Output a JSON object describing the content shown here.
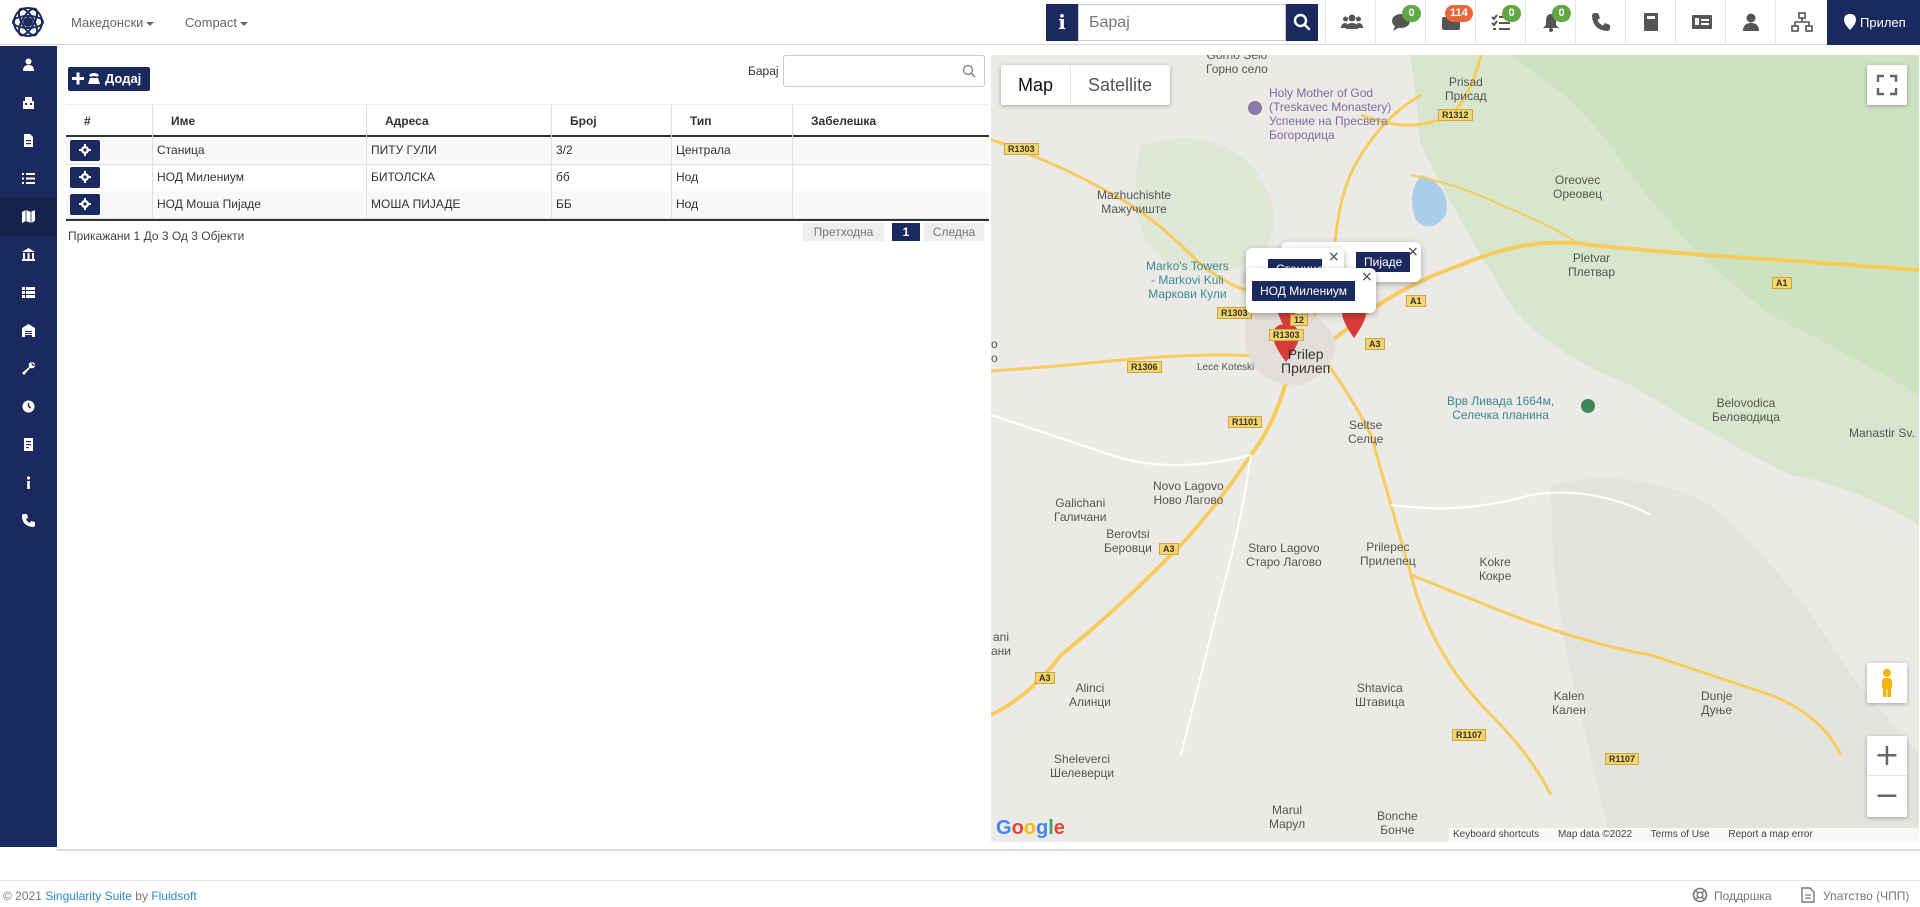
{
  "topbar": {
    "language": "Македонски",
    "view_mode": "Compact",
    "search_placeholder": "Барај",
    "badges": {
      "messages": "0",
      "inbox": "114",
      "tasks": "0",
      "notifications": "0"
    },
    "branch": "Прилеп"
  },
  "toolbar": {
    "add_label": "Додај",
    "filter_label": "Барај"
  },
  "table": {
    "columns": [
      "#",
      "Име",
      "Адреса",
      "Број",
      "Тип",
      "Забелешка"
    ],
    "rows": [
      {
        "name": "Станица",
        "address": "ПИТУ ГУЛИ",
        "number": "3/2",
        "type": "Централа",
        "note": ""
      },
      {
        "name": "НОД Милениум",
        "address": "БИТОЛСКА",
        "number": "бб",
        "type": "Нод",
        "note": ""
      },
      {
        "name": "НОД Моша Пијаде",
        "address": "МОША ПИЈАДЕ",
        "number": "ББ",
        "type": "Нод",
        "note": ""
      }
    ],
    "info": "Прикажани 1 До 3 Од 3 Објекти",
    "pagination": {
      "prev": "Претходна",
      "current": "1",
      "next": "Следна"
    }
  },
  "map": {
    "type_buttons": {
      "map": "Map",
      "satellite": "Satellite"
    },
    "infowindows": {
      "a_partial": "Станица",
      "b_partial": "Пијаде",
      "c": "НОД Милениум"
    },
    "labels": {
      "gorno_selo": "Gorno Selo\nГорно село",
      "holy_mother": "Holy Mother of God\n(Treskavec Monastery)\nУспение на Пресвета\nБогородица",
      "prisad": "Prisad\nПрисад",
      "mazhuchishte": "Mazhuchishte\nМажучиште",
      "oreovec": "Oreovec\nОреовец",
      "markos_towers": "Marko's Towers\n- Markovi Kuli\nМаркови Кули",
      "pletvar": "Pletvar\nПлетвар",
      "prilep": "Prilep\nПрилеп",
      "lece_koteski": "Lece Koteski",
      "vrv_livada": "Врв Ливада 1664м,\nСелечка планина",
      "belovodica": "Belovodica\nБеловодица",
      "manastir": "Manastir Sv. Ilija",
      "seltse": "Seltse\nСелце",
      "novo_lagovo": "Novo Lagovo\nНово Лагово",
      "galichani": "Galichani\nГаличани",
      "berovtsi": "Berovtsi\nБеровци",
      "staro_lagovo": "Staro Lagovo\nСтаро Лагово",
      "prilepec": "Prilepec\nПрилепец",
      "kokre": "Kokre\nКокре",
      "alinci": "Alinci\nАлинци",
      "shtavica": "Shtavica\nШтавица",
      "kalen": "Kalen\nКален",
      "dunje": "Dunje\nДуње",
      "sheleverci": "Sheleverci\nШелеверци",
      "marul": "Marul\nМарул",
      "bonche": "Bonche\nБонче",
      "edge_o": "o\nо",
      "edge_ani": "ani\nани"
    },
    "shields": {
      "r1312": "R1312",
      "r1303a": "R1303",
      "r1303b": "R1303",
      "r1303c": "R1303",
      "r12": "12",
      "a1a": "A1",
      "a1b": "A1",
      "a3a": "A3",
      "a3b": "A3",
      "a3c": "A3",
      "r1306": "R1306",
      "r1101": "R1101",
      "r1107a": "R1107",
      "r1107b": "R1107"
    },
    "google": "Google",
    "attribution": [
      "Keyboard shortcuts",
      "Map data ©2022",
      "Terms of Use",
      "Report a map error"
    ],
    "colors": {
      "marker": "#d73b37",
      "road": "#f7cc5d",
      "forest": "#cfe5c6"
    }
  },
  "footer": {
    "year": "© 2021",
    "product": "Singularity Suite",
    "by": "by",
    "company": "Fluidsoft",
    "support": "Поддршка",
    "manual": "Упатство (ЧПП)"
  },
  "colors": {
    "primary": "#1a2a5e",
    "badge_green": "#62a745",
    "badge_orange": "#e8673a",
    "link": "#2b8ac7"
  }
}
